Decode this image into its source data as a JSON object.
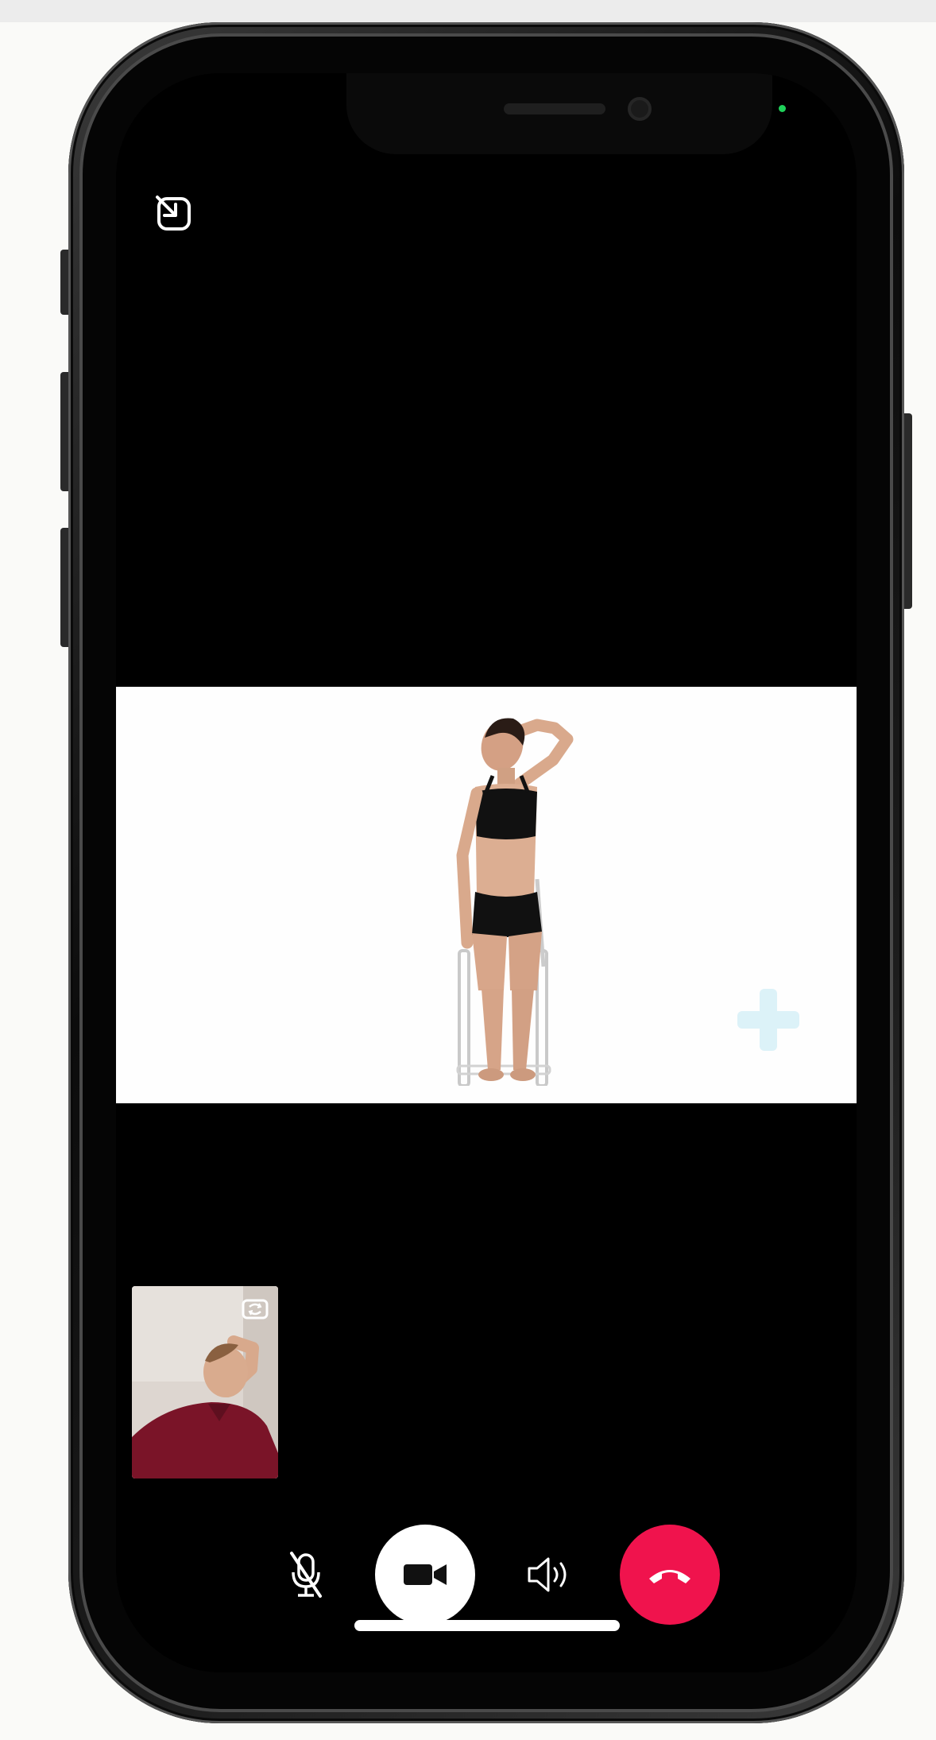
{
  "theme": {
    "end_call_color": "#f0134d",
    "status_dot_color": "#1fd15a",
    "plus_color": "#9fdcef",
    "remote_background": "#fefefe",
    "self_shirt_color": "#7a1428"
  },
  "icons": {
    "pip_exit": "pip-exit-icon",
    "camera_flip": "camera-flip-icon",
    "mute": "mic-off-icon",
    "video": "video-camera-icon",
    "speaker": "speaker-icon",
    "end_call": "phone-hangup-icon",
    "decor": "plus-icon"
  },
  "call": {
    "remote_participant": "exercise-demo-video",
    "self_participant": "self-camera-preview"
  }
}
